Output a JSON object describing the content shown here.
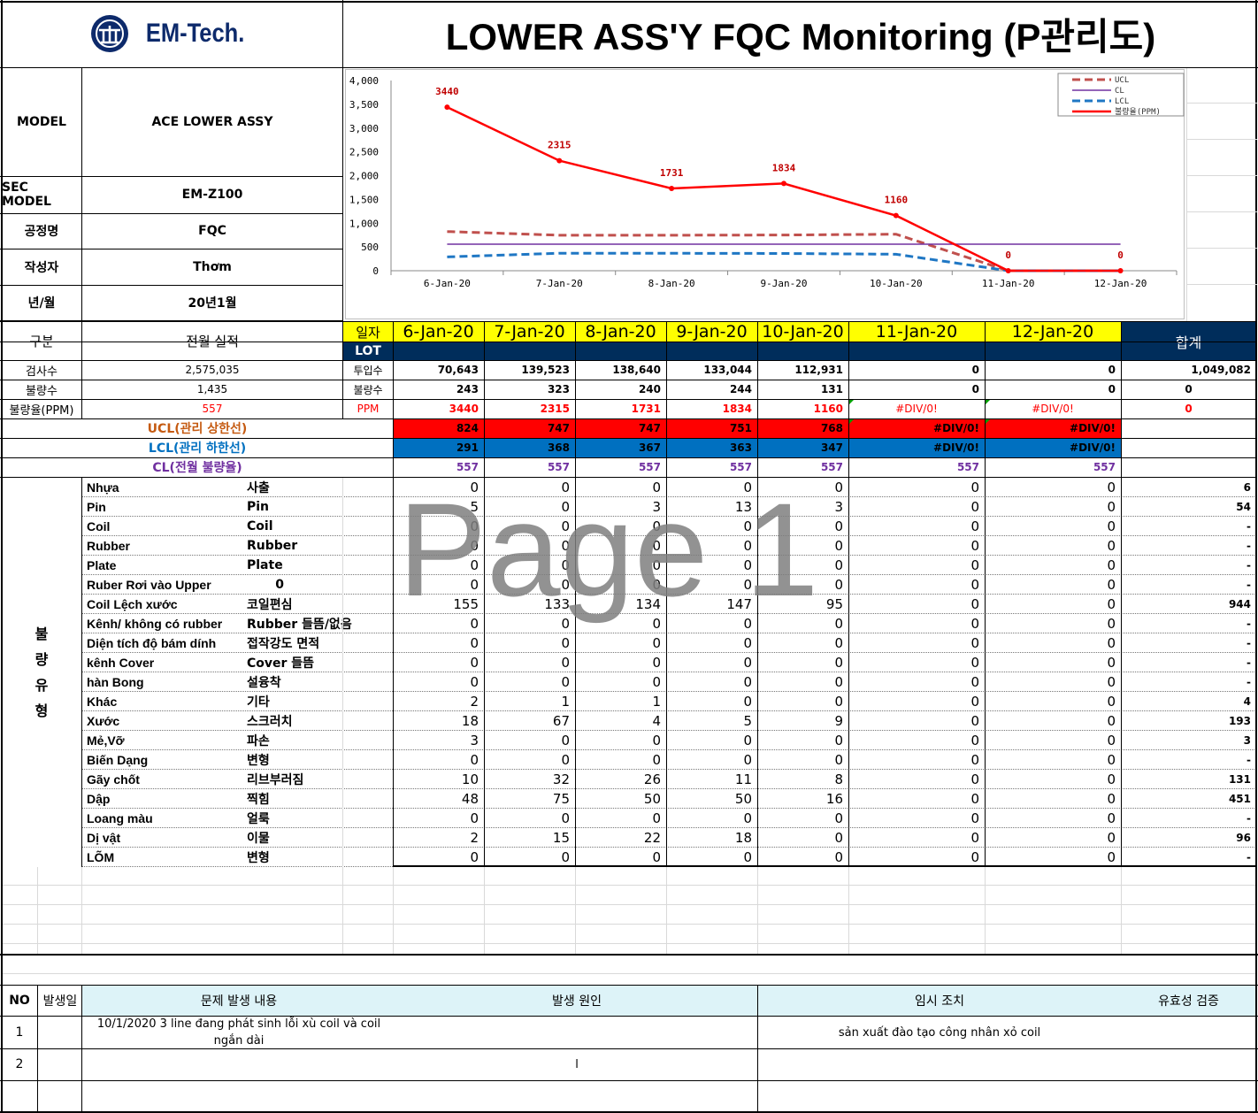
{
  "header": {
    "logo_text": "EM-Tech.",
    "title": "LOWER ASS'Y FQC Monitoring (P관리도)"
  },
  "info": [
    {
      "label": "MODEL",
      "value": "ACE LOWER ASSY"
    },
    {
      "label": "SEC MODEL",
      "value": "EM-Z100"
    },
    {
      "label": "공정명",
      "value": "FQC"
    },
    {
      "label": "작성자",
      "value": "Thơm"
    },
    {
      "label": "년/월",
      "value": "20년1월"
    }
  ],
  "chart_data": {
    "type": "line",
    "categories": [
      "6-Jan-20",
      "7-Jan-20",
      "8-Jan-20",
      "9-Jan-20",
      "10-Jan-20",
      "11-Jan-20",
      "12-Jan-20"
    ],
    "ylim": [
      0,
      4000
    ],
    "yticks": [
      "4,000",
      "3,500",
      "3,000",
      "2,500",
      "2,000",
      "1,500",
      "1,000",
      "500",
      "0"
    ],
    "series": [
      {
        "name": "UCL",
        "color": "#c0504d",
        "values": [
          824,
          747,
          747,
          751,
          768,
          0,
          0
        ]
      },
      {
        "name": "CL",
        "color": "#7030a0",
        "values": [
          557,
          557,
          557,
          557,
          557,
          557,
          557
        ]
      },
      {
        "name": "LCL",
        "color": "#1f77c4",
        "values": [
          291,
          368,
          367,
          363,
          347,
          0,
          0
        ]
      },
      {
        "name": "불량율(PPM)",
        "color": "#ff0000",
        "values": [
          3440,
          2315,
          1731,
          1834,
          1160,
          0,
          0
        ],
        "labels": [
          "3440",
          "2315",
          "1731",
          "1834",
          "1160",
          "0",
          "0"
        ]
      }
    ],
    "legend": "top-right"
  },
  "summary": {
    "gubun": "구분",
    "prev": "전월 실적",
    "ilja": "일자",
    "lot": "LOT",
    "total": "합계",
    "dates": [
      "6-Jan-20",
      "7-Jan-20",
      "8-Jan-20",
      "9-Jan-20",
      "10-Jan-20",
      "11-Jan-20",
      "12-Jan-20"
    ],
    "rows": [
      {
        "label": "검사수",
        "prev": "2,575,035",
        "sub": "투입수",
        "vals": [
          "70,643",
          "139,523",
          "138,640",
          "133,044",
          "112,931",
          "0",
          "0"
        ],
        "total": "1,049,082"
      },
      {
        "label": "불량수",
        "prev": "1,435",
        "sub": "불량수",
        "vals": [
          "243",
          "323",
          "240",
          "244",
          "131",
          "0",
          "0"
        ],
        "total": "0"
      },
      {
        "label": "불량율(PPM)",
        "prev": "557",
        "sub": "PPM",
        "vals": [
          "3440",
          "2315",
          "1731",
          "1834",
          "1160",
          "#DIV/0!",
          "#DIV/0!"
        ],
        "total": "0"
      }
    ],
    "ucl": {
      "label": "UCL(관리 상한선)",
      "vals": [
        "824",
        "747",
        "747",
        "751",
        "768",
        "#DIV/0!",
        "#DIV/0!"
      ]
    },
    "lcl": {
      "label": "LCL(관리 하한선)",
      "vals": [
        "291",
        "368",
        "367",
        "363",
        "347",
        "#DIV/0!",
        "#DIV/0!"
      ]
    },
    "cl": {
      "label": "CL(전월 불량율)",
      "vals": [
        "557",
        "557",
        "557",
        "557",
        "557",
        "557",
        "557"
      ]
    }
  },
  "defects": {
    "side_label": [
      "불",
      "량",
      "유",
      "형"
    ],
    "watermark": "Page 1",
    "rows": [
      {
        "vn": "Nhựa",
        "kr": "사출",
        "vals": [
          "0",
          "0",
          "0",
          "0",
          "0",
          "0",
          "0"
        ],
        "total": "6"
      },
      {
        "vn": "Pin",
        "kr": "Pin",
        "vals": [
          "5",
          "0",
          "3",
          "13",
          "3",
          "0",
          "0"
        ],
        "total": "54"
      },
      {
        "vn": "Coil",
        "kr": "Coil",
        "vals": [
          "0",
          "0",
          "0",
          "0",
          "0",
          "0",
          "0"
        ],
        "total": "-"
      },
      {
        "vn": "Rubber",
        "kr": "Rubber",
        "vals": [
          "0",
          "0",
          "0",
          "0",
          "0",
          "0",
          "0"
        ],
        "total": "-"
      },
      {
        "vn": "Plate",
        "kr": "Plate",
        "vals": [
          "0",
          "0",
          "0",
          "0",
          "0",
          "0",
          "0"
        ],
        "total": "-"
      },
      {
        "vn": "Ruber Rơi vào Upper",
        "kr": "0",
        "vals": [
          "0",
          "0",
          "0",
          "0",
          "0",
          "0",
          "0"
        ],
        "total": "-"
      },
      {
        "vn": "Coil Lệch xước",
        "kr": "코일편심",
        "vals": [
          "155",
          "133",
          "134",
          "147",
          "95",
          "0",
          "0"
        ],
        "total": "944"
      },
      {
        "vn": "Kênh/ không có rubber",
        "kr": "Rubber 들뜸/없음",
        "vals": [
          "0",
          "0",
          "0",
          "0",
          "0",
          "0",
          "0"
        ],
        "total": "-"
      },
      {
        "vn": "Diện tích độ bám dính",
        "kr": "접작강도 면적",
        "vals": [
          "0",
          "0",
          "0",
          "0",
          "0",
          "0",
          "0"
        ],
        "total": "-"
      },
      {
        "vn": "kênh Cover",
        "kr": "Cover 들뜸",
        "vals": [
          "0",
          "0",
          "0",
          "0",
          "0",
          "0",
          "0"
        ],
        "total": "-"
      },
      {
        "vn": "hàn Bong",
        "kr": "설융착",
        "vals": [
          "0",
          "0",
          "0",
          "0",
          "0",
          "0",
          "0"
        ],
        "total": "-"
      },
      {
        "vn": "Khác",
        "kr": "기타",
        "vals": [
          "2",
          "1",
          "1",
          "0",
          "0",
          "0",
          "0"
        ],
        "total": "4"
      },
      {
        "vn": "Xước",
        "kr": "스크러치",
        "vals": [
          "18",
          "67",
          "4",
          "5",
          "9",
          "0",
          "0"
        ],
        "total": "193"
      },
      {
        "vn": "Mẻ,Vỡ",
        "kr": "파손",
        "vals": [
          "3",
          "0",
          "0",
          "0",
          "0",
          "0",
          "0"
        ],
        "total": "3"
      },
      {
        "vn": "Biến Dạng",
        "kr": "변형",
        "vals": [
          "0",
          "0",
          "0",
          "0",
          "0",
          "0",
          "0"
        ],
        "total": "-"
      },
      {
        "vn": "Gãy chốt",
        "kr": "리브부러짐",
        "vals": [
          "10",
          "32",
          "26",
          "11",
          "8",
          "0",
          "0"
        ],
        "total": "131"
      },
      {
        "vn": "Dập",
        "kr": "찍힘",
        "vals": [
          "48",
          "75",
          "50",
          "50",
          "16",
          "0",
          "0"
        ],
        "total": "451"
      },
      {
        "vn": "Loang màu",
        "kr": "얼룩",
        "vals": [
          "0",
          "0",
          "0",
          "0",
          "0",
          "0",
          "0"
        ],
        "total": "-"
      },
      {
        "vn": "Dị vật",
        "kr": "이물",
        "vals": [
          "2",
          "15",
          "22",
          "18",
          "0",
          "0",
          "0"
        ],
        "total": "96"
      },
      {
        "vn": "LÕM",
        "kr": "변형",
        "vals": [
          "0",
          "0",
          "0",
          "0",
          "0",
          "0",
          "0"
        ],
        "total": "-"
      }
    ]
  },
  "issues": {
    "headers": {
      "no": "NO",
      "date": "발생일",
      "content": "문제 발생 내용",
      "cause": "발생 원인",
      "action": "임시 조치",
      "verify": "유효성 검증"
    },
    "rows": [
      {
        "no": "1",
        "date": "",
        "content": "10/1/2020 3 line đang phát sinh lỗi xù coil và coil ngắn dài",
        "cause": "",
        "action": "sản xuất đào tạo công nhân xỏ coil",
        "verify": ""
      },
      {
        "no": "2",
        "date": "",
        "content": "",
        "cause": "l",
        "action": "",
        "verify": ""
      }
    ]
  }
}
